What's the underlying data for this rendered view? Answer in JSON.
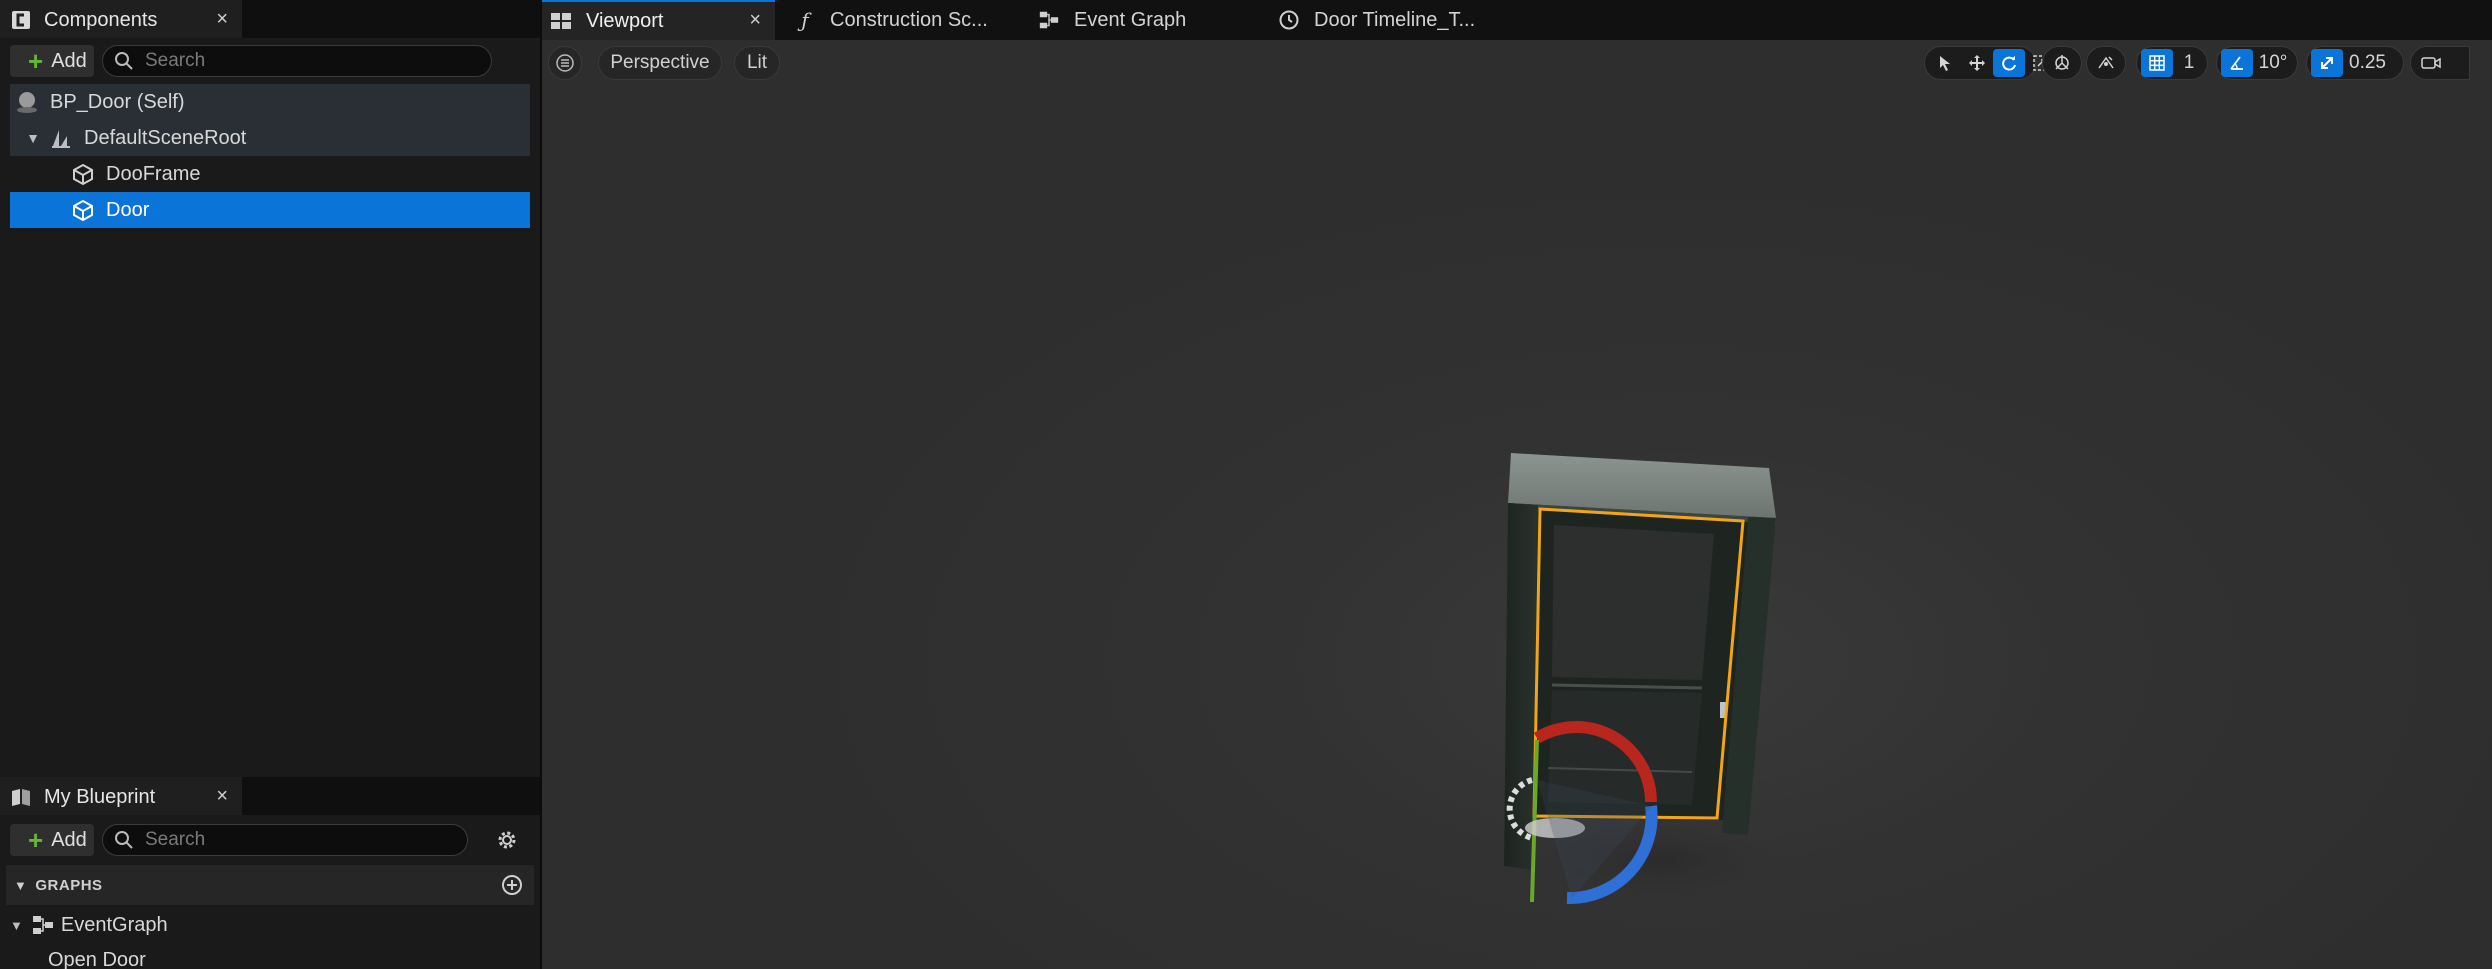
{
  "components_panel": {
    "tab_title": "Components",
    "close_glyph": "×",
    "add_label": "Add",
    "search_placeholder": "Search",
    "tree": [
      {
        "label": "BP_Door (Self)",
        "icon": "actor-sphere-icon"
      },
      {
        "label": "DefaultSceneRoot",
        "icon": "scene-root-icon"
      },
      {
        "label": "DooFrame",
        "icon": "static-mesh-icon"
      },
      {
        "label": "Door",
        "icon": "static-mesh-icon",
        "selected": true
      }
    ]
  },
  "my_blueprint_panel": {
    "tab_title": "My Blueprint",
    "close_glyph": "×",
    "add_label": "Add",
    "search_placeholder": "Search",
    "graphs_header": "GRAPHS",
    "graphs": [
      {
        "label": "EventGraph",
        "children": [
          "Open Door"
        ]
      }
    ]
  },
  "document_tabs": [
    {
      "label": "Viewport",
      "icon": "viewport-grid-icon",
      "active": true,
      "close_glyph": "×"
    },
    {
      "label": "Construction Sc...",
      "icon": "function-icon"
    },
    {
      "label": "Event Graph",
      "icon": "event-graph-icon"
    },
    {
      "label": "Door Timeline_T...",
      "icon": "clock-icon"
    }
  ],
  "viewport_toolbar": {
    "menu_icon": "hamburger-icon",
    "view_mode": "Perspective",
    "lighting_mode": "Lit",
    "grid_snap_value": "1",
    "rotation_snap_value": "10°",
    "scale_snap_value": "0.25"
  },
  "colors": {
    "accent": "#0a74d8",
    "add_plus": "#67b536",
    "selection_outline": "#f2a516",
    "gizmo_red": "#b8261d",
    "gizmo_green": "#6aa82c",
    "gizmo_blue": "#2f6fd6",
    "viewport_bg": "#323232"
  }
}
